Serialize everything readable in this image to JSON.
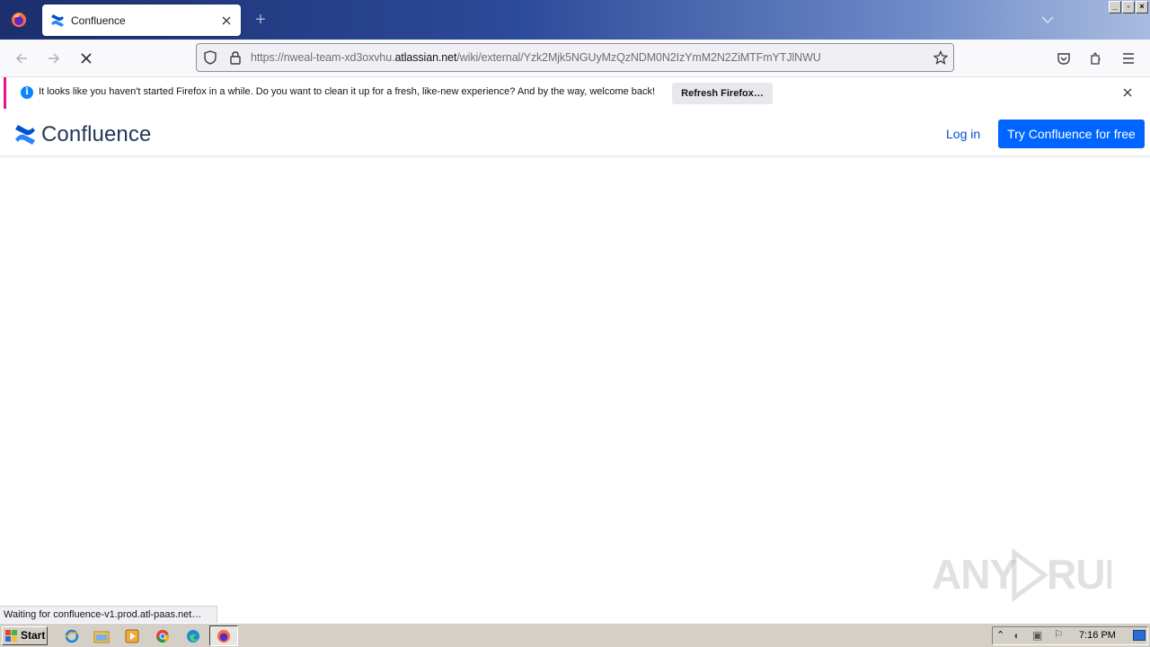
{
  "browser": {
    "tab_title": "Confluence",
    "new_tab_label": "+",
    "url_prefix": "https://nweal-team-xd3oxvhu.",
    "url_host": "atlassian.net",
    "url_path": "/wiki/external/Yzk2Mjk5NGUyMzQzNDM0N2IzYmM2N2ZiMTFmYTJlNWU"
  },
  "notification": {
    "message": "It looks like you haven't started Firefox in a while. Do you want to clean it up for a fresh, like-new experience? And by the way, welcome back!",
    "button_label": "Refresh Firefox…",
    "info_glyph": "i"
  },
  "page": {
    "logo_text": "Confluence",
    "login_label": "Log in",
    "try_label": "Try Confluence for free"
  },
  "watermark": "ANY RUN",
  "status_text": "Waiting for confluence-v1.prod.atl-paas.net…",
  "taskbar": {
    "start_label": "Start",
    "clock": "7:16 PM"
  },
  "colors": {
    "accent": "#0065ff",
    "link": "#0052cc",
    "logo_text": "#253858",
    "notif_stripe": "#e31587"
  },
  "icons": [
    "firefox-icon",
    "confluence-icon",
    "close-icon",
    "plus-icon",
    "chevron-down-icon",
    "back-icon",
    "forward-icon",
    "stop-icon",
    "shield-icon",
    "lock-icon",
    "star-icon",
    "pocket-icon",
    "extensions-icon",
    "menu-icon",
    "info-icon",
    "ie-icon",
    "folder-icon",
    "media-icon",
    "chrome-icon",
    "edge-icon"
  ]
}
